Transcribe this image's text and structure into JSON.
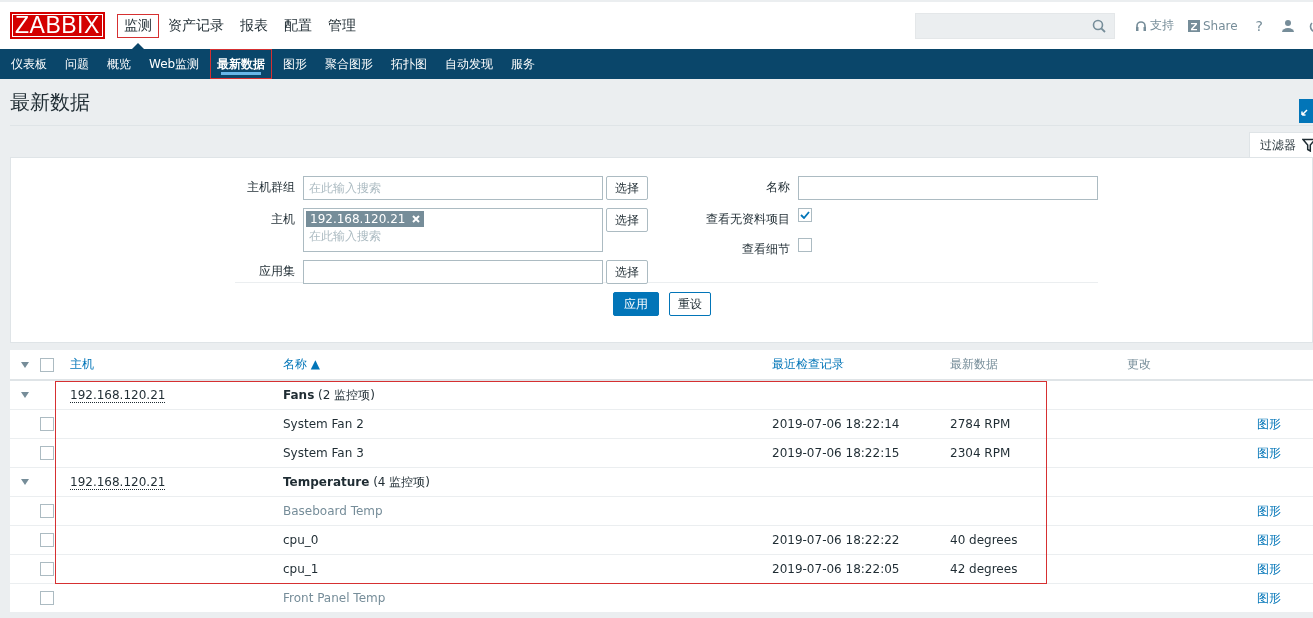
{
  "header": {
    "logo": "ZABBIX",
    "menu": [
      {
        "label": "监测",
        "selected": true,
        "annotated": true
      },
      {
        "label": "资产记录",
        "selected": false,
        "annotated": false
      },
      {
        "label": "报表",
        "selected": false,
        "annotated": false
      },
      {
        "label": "配置",
        "selected": false,
        "annotated": false
      },
      {
        "label": "管理",
        "selected": false,
        "annotated": false
      }
    ],
    "support": "支持",
    "share": "Share",
    "help": "?"
  },
  "submenu": [
    {
      "label": "仪表板",
      "selected": false,
      "annotated": false
    },
    {
      "label": "问题",
      "selected": false,
      "annotated": false
    },
    {
      "label": "概览",
      "selected": false,
      "annotated": false
    },
    {
      "label": "Web监测",
      "selected": false,
      "annotated": false
    },
    {
      "label": "最新数据",
      "selected": true,
      "annotated": true
    },
    {
      "label": "图形",
      "selected": false,
      "annotated": false
    },
    {
      "label": "聚合图形",
      "selected": false,
      "annotated": false
    },
    {
      "label": "拓扑图",
      "selected": false,
      "annotated": false
    },
    {
      "label": "自动发现",
      "selected": false,
      "annotated": false
    },
    {
      "label": "服务",
      "selected": false,
      "annotated": false
    }
  ],
  "page_title": "最新数据",
  "filter": {
    "tab": "过滤器",
    "host_groups": {
      "label": "主机群组",
      "placeholder": "在此输入搜索",
      "button": "选择"
    },
    "hosts": {
      "label": "主机",
      "tags": [
        "192.168.120.21"
      ],
      "placeholder": "在此输入搜索",
      "button": "选择"
    },
    "applications": {
      "label": "应用集",
      "button": "选择"
    },
    "name": {
      "label": "名称"
    },
    "show_items_without_data": {
      "label": "查看无资料项目",
      "checked": true
    },
    "show_details": {
      "label": "查看细节",
      "checked": false
    },
    "apply": "应用",
    "reset": "重设"
  },
  "table": {
    "select_all_checked": false,
    "columns": [
      "主机",
      "名称 ▲",
      "最近检查记录",
      "最新数据",
      "更改"
    ],
    "groups": [
      {
        "host": "192.168.120.21",
        "name": "Fans",
        "count": "(2 监控项)",
        "expanded": true,
        "annotated": true,
        "items": [
          {
            "checked": false,
            "name": "System Fan 2",
            "last_check": "2019-07-06 18:22:14",
            "value": "2784 RPM",
            "link": "图形",
            "disabled": false,
            "annotated": true
          },
          {
            "checked": false,
            "name": "System Fan 3",
            "last_check": "2019-07-06 18:22:15",
            "value": "2304 RPM",
            "link": "图形",
            "disabled": false,
            "annotated": true
          }
        ]
      },
      {
        "host": "192.168.120.21",
        "name": "Temperature",
        "count": "(4 监控项)",
        "expanded": true,
        "annotated": true,
        "items": [
          {
            "checked": false,
            "name": "Baseboard Temp",
            "link": "图形",
            "disabled": true,
            "annotated": true
          },
          {
            "checked": false,
            "name": "cpu_0",
            "last_check": "2019-07-06 18:22:22",
            "value": "40 degrees",
            "link": "图形",
            "disabled": false,
            "annotated": true
          },
          {
            "checked": false,
            "name": "cpu_1",
            "last_check": "2019-07-06 18:22:05",
            "value": "42 degrees",
            "link": "图形",
            "disabled": false,
            "annotated": true
          },
          {
            "checked": false,
            "name": "Front Panel Temp",
            "link": "图形",
            "disabled": true,
            "annotated": false
          }
        ]
      }
    ]
  }
}
